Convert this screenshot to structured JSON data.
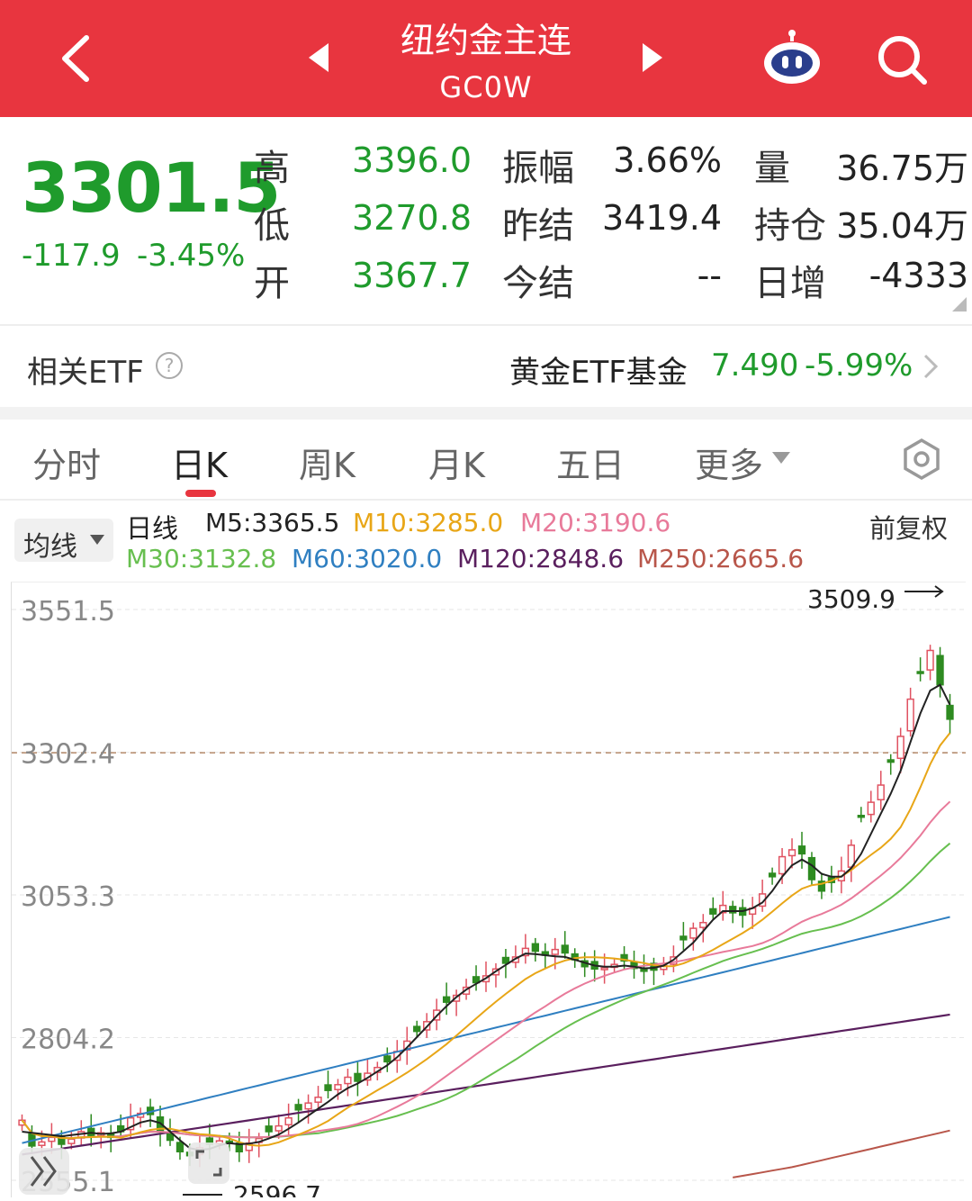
{
  "header": {
    "title": "纽约金主连",
    "code": "GC0W"
  },
  "quote": {
    "price": "3301.5",
    "change": "-117.9",
    "change_pct": "-3.45%",
    "rows": [
      [
        {
          "label": "高",
          "value": "3396.0"
        },
        {
          "label": "振幅",
          "value": "3.66%"
        },
        {
          "label": "量",
          "value": "36.75万"
        }
      ],
      [
        {
          "label": "低",
          "value": "3270.8"
        },
        {
          "label": "昨结",
          "value": "3419.4"
        },
        {
          "label": "持仓",
          "value": "35.04万"
        }
      ],
      [
        {
          "label": "开",
          "value": "3367.7"
        },
        {
          "label": "今结",
          "value": "--"
        },
        {
          "label": "日增",
          "value": "-4333"
        }
      ]
    ]
  },
  "etf": {
    "label": "相关ETF",
    "name": "黄金ETF基金",
    "price": "7.490",
    "change_pct": "-5.99%"
  },
  "tabs": [
    "分时",
    "日K",
    "周K",
    "月K",
    "五日",
    "更多"
  ],
  "ma_bar": {
    "selector": "均线",
    "prefix": "日线",
    "adjust": "前复权",
    "items": [
      {
        "label": "M5:3365.5",
        "color": "#222222"
      },
      {
        "label": "M10:3285.0",
        "color": "#e8a617"
      },
      {
        "label": "M20:3190.6",
        "color": "#e87a9a"
      },
      {
        "label": "M30:3132.8",
        "color": "#67bf4f"
      },
      {
        "label": "M60:3020.0",
        "color": "#2f7fc1"
      },
      {
        "label": "M120:2848.6",
        "color": "#5a1f5e"
      },
      {
        "label": "M250:2665.6",
        "color": "#b8564a"
      }
    ]
  },
  "colors": {
    "up": "#e05261",
    "down": "#2e8b21",
    "accent": "#e8353f"
  },
  "chart_data": {
    "type": "candlestick",
    "y_ticks": [
      "3551.5",
      "3302.4",
      "3053.3",
      "2804.2",
      "2555.1"
    ],
    "ylim": [
      2555.1,
      3551.5
    ],
    "current_price": 3301.5,
    "max_marker": "3509.9",
    "min_marker": "2596.7",
    "close": [
      2660,
      2615,
      2622,
      2630,
      2618,
      2627,
      2640,
      2632,
      2638,
      2630,
      2640,
      2664,
      2672,
      2670,
      2640,
      2625,
      2605,
      2598,
      2612,
      2618,
      2624,
      2620,
      2605,
      2620,
      2628,
      2640,
      2650,
      2664,
      2678,
      2690,
      2700,
      2712,
      2722,
      2735,
      2728,
      2742,
      2752,
      2762,
      2780,
      2798,
      2815,
      2832,
      2852,
      2866,
      2878,
      2892,
      2900,
      2912,
      2924,
      2934,
      2945,
      2960,
      2955,
      2948,
      2958,
      2952,
      2940,
      2928,
      2924,
      2926,
      2932,
      2938,
      2925,
      2920,
      2922,
      2930,
      2945,
      2975,
      2995,
      3005,
      3020,
      3035,
      3022,
      3018,
      3030,
      3055,
      3085,
      3120,
      3132,
      3125,
      3080,
      3060,
      3075,
      3095,
      3140,
      3190,
      3215,
      3245,
      3285,
      3330,
      3395,
      3440,
      3480,
      3420,
      3360
    ],
    "ma5": [
      2640,
      2638,
      2636,
      2634,
      2632,
      2634,
      2636,
      2638,
      2636,
      2637,
      2640,
      2648,
      2656,
      2660,
      2655,
      2640,
      2625,
      2611,
      2608,
      2610,
      2616,
      2620,
      2618,
      2619,
      2622,
      2628,
      2635,
      2645,
      2656,
      2668,
      2680,
      2692,
      2705,
      2716,
      2724,
      2734,
      2745,
      2756,
      2770,
      2787,
      2805,
      2823,
      2842,
      2859,
      2875,
      2888,
      2898,
      2908,
      2920,
      2931,
      2942,
      2951,
      2950,
      2948,
      2946,
      2945,
      2940,
      2935,
      2930,
      2928,
      2928,
      2930,
      2928,
      2925,
      2926,
      2930,
      2940,
      2955,
      2970,
      2990,
      3010,
      3025,
      3025,
      3025,
      3030,
      3040,
      3060,
      3085,
      3105,
      3115,
      3105,
      3090,
      3085,
      3085,
      3100,
      3125,
      3160,
      3195,
      3230,
      3270,
      3320,
      3370,
      3410,
      3420,
      3385
    ],
    "ma250": [
      null,
      null,
      null,
      null,
      null,
      null,
      null,
      null,
      null,
      null,
      null,
      null,
      null,
      null,
      null,
      null,
      null,
      null,
      null,
      null,
      null,
      null,
      null,
      null,
      null,
      null,
      null,
      null,
      null,
      null,
      null,
      null,
      null,
      null,
      null,
      null,
      null,
      null,
      null,
      null,
      null,
      null,
      null,
      null,
      null,
      null,
      null,
      null,
      null,
      null,
      null,
      null,
      null,
      null,
      null,
      null,
      null,
      null,
      null,
      null,
      null,
      null,
      null,
      null,
      null,
      null,
      null,
      null,
      null,
      null,
      null,
      null,
      2560,
      2563,
      2566,
      2569,
      2572,
      2575,
      2578,
      2582,
      2586,
      2590,
      2594,
      2598,
      2602,
      2606,
      2610,
      2614,
      2618,
      2622,
      2626,
      2630,
      2634,
      2638,
      2642
    ]
  }
}
